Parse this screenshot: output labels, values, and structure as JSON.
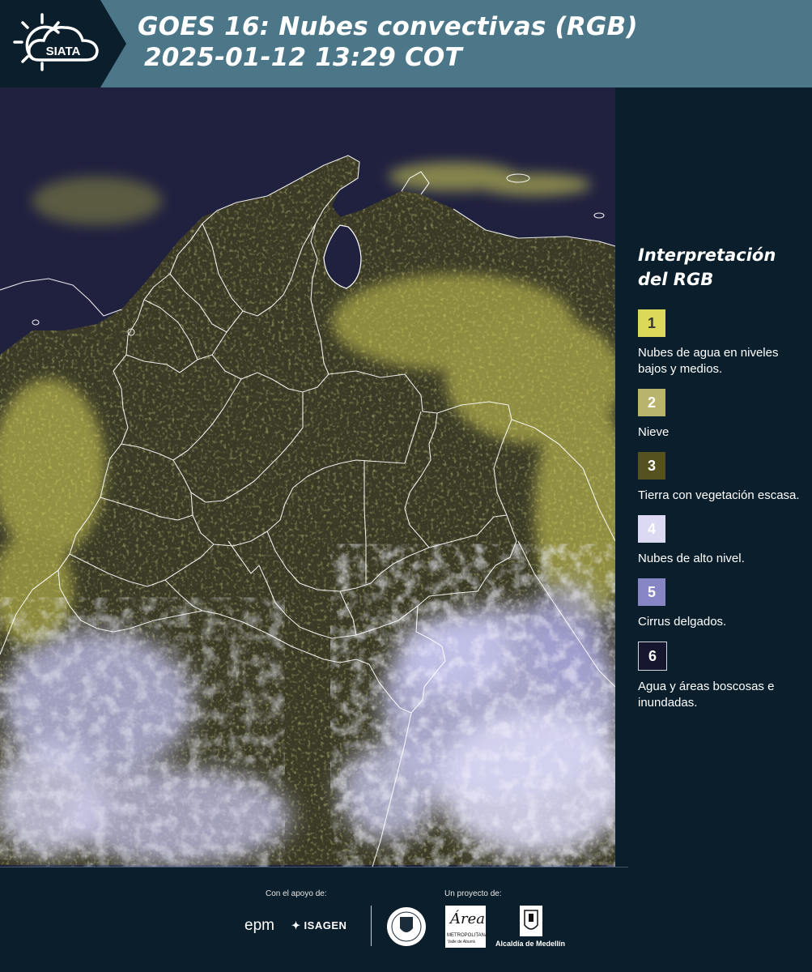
{
  "header": {
    "logo_text": "SIATA",
    "title_line1": "GOES 16: Nubes convectivas (RGB)",
    "title_line2": "2025-01-12 13:29 COT",
    "colors": {
      "bar": "#4c7789",
      "logo_bg": "#0b1e2b"
    }
  },
  "map": {
    "description_icon": "satellite-map",
    "colors": {
      "background": "#20213f",
      "water_clouds": "#e2e25a",
      "land": "#4a4a24",
      "high_clouds": "#d8d8f2",
      "cirrus": "#8584c4",
      "borders": "#ffffff"
    }
  },
  "legend": {
    "title_line1": "Interpretación",
    "title_line2": "del RGB",
    "items": [
      {
        "number": "1",
        "label": "Nubes de agua en niveles bajos y medios.",
        "color": "#dbd85a",
        "text_color": "#333333"
      },
      {
        "number": "2",
        "label": "Nieve",
        "color": "#b8b46e",
        "text_color": "#ffffff"
      },
      {
        "number": "3",
        "label": "Tierra con vegetación escasa.",
        "color": "#56521f",
        "text_color": "#ffffff"
      },
      {
        "number": "4",
        "label": "Nubes de alto nivel.",
        "color": "#dcdaf2",
        "text_color": "#ffffff"
      },
      {
        "number": "5",
        "label": "Cirrus delgados.",
        "color": "#8686c4",
        "text_color": "#ffffff"
      },
      {
        "number": "6",
        "label": "Agua y áreas boscosas e inundadas.",
        "color": "#16162e",
        "text_color": "#ffffff"
      }
    ]
  },
  "footer": {
    "support_label": "Con el apoyo de:",
    "project_label": "Un proyecto de:",
    "logos": {
      "epm": "epm",
      "isagen": "ISAGEN",
      "area_name": "Área",
      "area_sub1": "METROPOLITANA",
      "area_sub2": "Valle de Aburrá",
      "alcaldia": "Alcaldía de Medellín"
    }
  }
}
